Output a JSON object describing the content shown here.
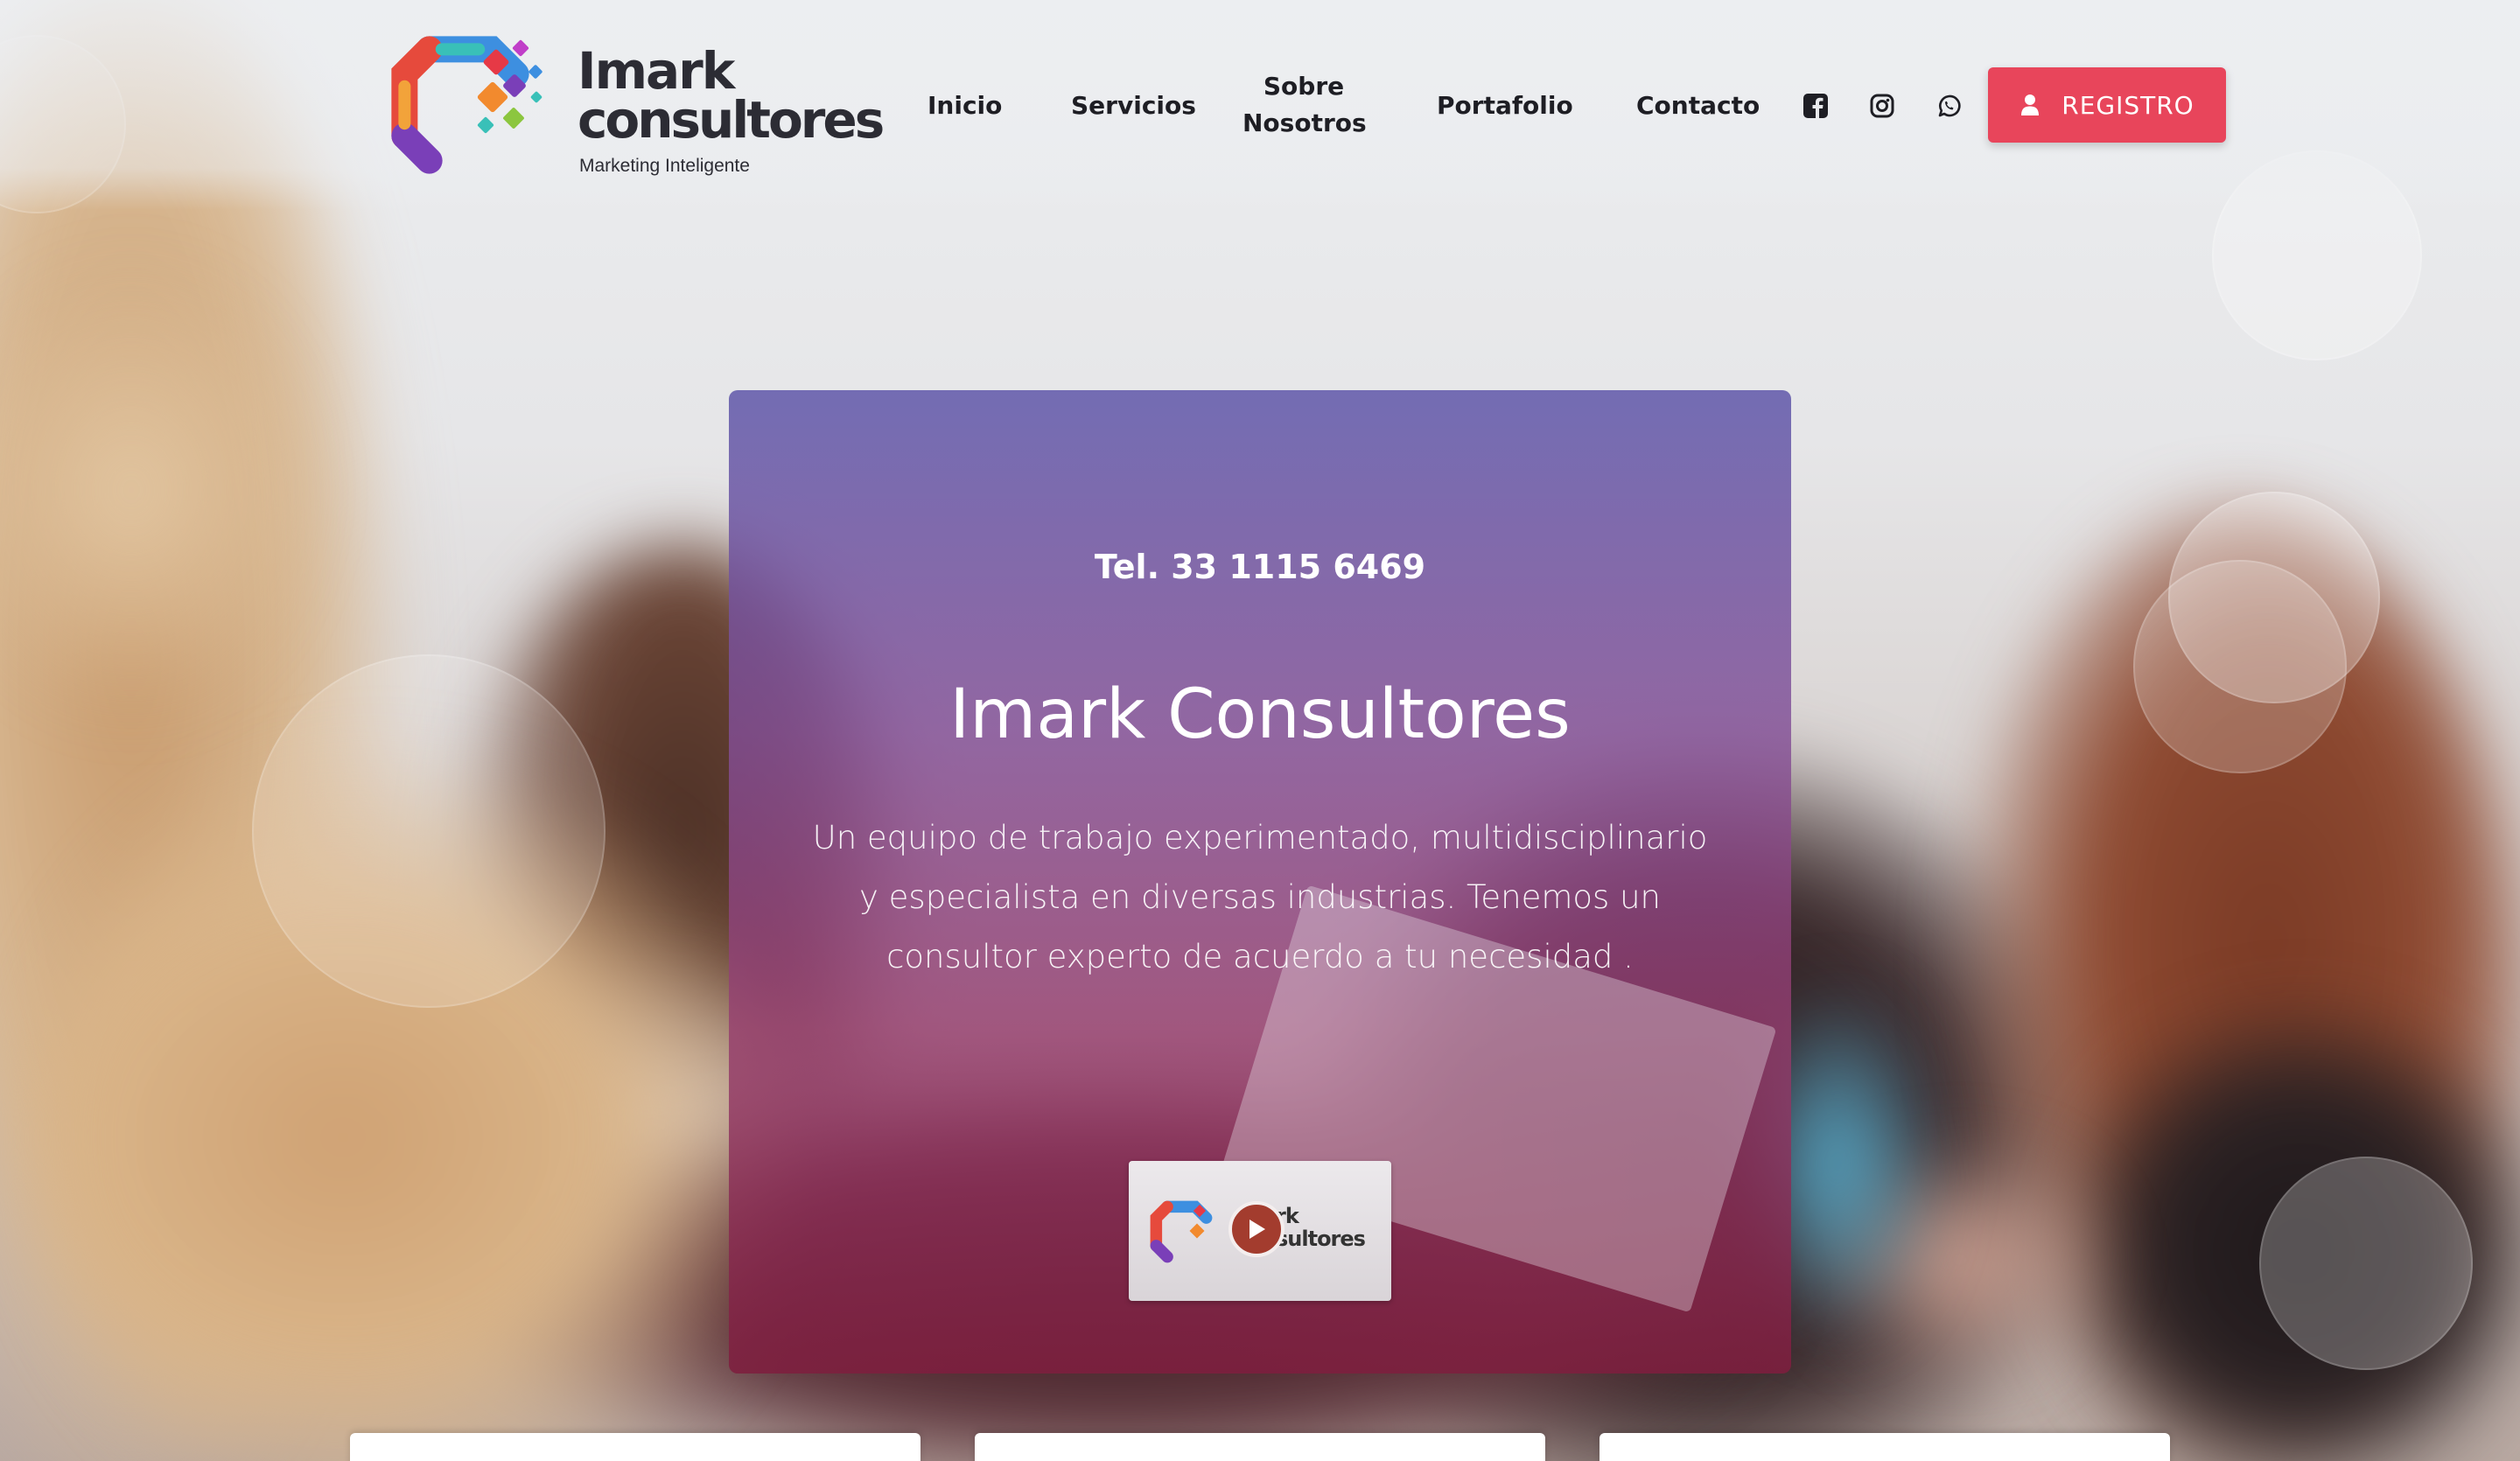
{
  "brand": {
    "name_line1": "Imark",
    "name_line2": "consultores",
    "tagline": "Marketing Inteligente"
  },
  "nav": {
    "items": [
      {
        "id": "inicio",
        "label": "Inicio"
      },
      {
        "id": "servicios",
        "label": "Servicios"
      },
      {
        "id": "sobre",
        "label": "Sobre Nosotros"
      },
      {
        "id": "portafolio",
        "label": "Portafolio"
      },
      {
        "id": "contacto",
        "label": "Contacto"
      }
    ],
    "social_icons": [
      "facebook-icon",
      "instagram-icon",
      "whatsapp-icon"
    ],
    "cta": {
      "label": "REGISTRO",
      "icon": "user-icon",
      "color": "#e8455b"
    }
  },
  "hero": {
    "phone": "Tel. 33 1115 6469",
    "title": "Imark Consultores",
    "description": "Un equipo de trabajo experimentado, multidisciplinario y especialista en diversas industrias. Tenemos un consultor experto de acuerdo a tu necesidad .",
    "video": {
      "thumb_text": "rk\nsultores",
      "icon": "play-icon"
    }
  },
  "colors": {
    "accent": "#e8455b",
    "hero_top": "#6058aa",
    "hero_bottom": "#7e1e3e",
    "text_dark": "#1e1e24"
  }
}
